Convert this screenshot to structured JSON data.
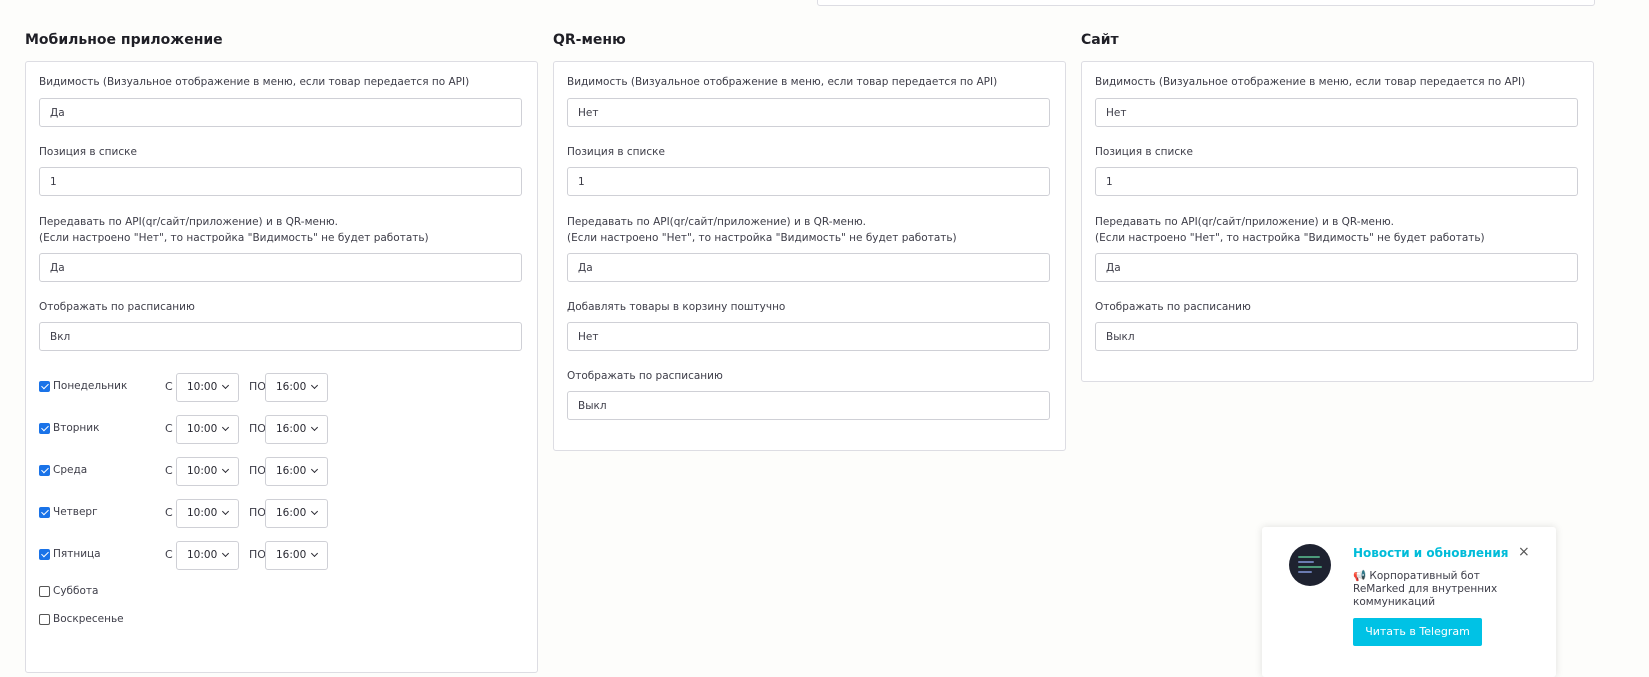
{
  "sections": [
    {
      "title": "Мобильное приложение",
      "visibility": {
        "label": "Видимость (Визуальное отображение в меню, если товар передается по API)",
        "value": "Да"
      },
      "position": {
        "label": "Позиция в списке",
        "value": "1"
      },
      "api": {
        "label_line1": "Передавать по API(qr/сайт/приложение) и в QR-меню.",
        "label_line2": "(Если настроено \"Нет\", то настройка \"Видимость\" не будет работать)",
        "value": "Да"
      },
      "schedule": {
        "label": "Отображать по расписанию",
        "value": "Вкл"
      },
      "days": [
        {
          "name": "Понедельник",
          "checked": true,
          "from": "10:00",
          "to": "16:00"
        },
        {
          "name": "Вторник",
          "checked": true,
          "from": "10:00",
          "to": "16:00"
        },
        {
          "name": "Среда",
          "checked": true,
          "from": "10:00",
          "to": "16:00"
        },
        {
          "name": "Четверг",
          "checked": true,
          "from": "10:00",
          "to": "16:00"
        },
        {
          "name": "Пятница",
          "checked": true,
          "from": "10:00",
          "to": "16:00"
        },
        {
          "name": "Суббота",
          "checked": false
        },
        {
          "name": "Воскресенье",
          "checked": false
        }
      ],
      "from_label": "С",
      "to_label": "ПО"
    },
    {
      "title": "QR-меню",
      "visibility": {
        "label": "Видимость (Визуальное отображение в меню, если товар передается по API)",
        "value": "Нет"
      },
      "position": {
        "label": "Позиция в списке",
        "value": "1"
      },
      "api": {
        "label_line1": "Передавать по API(qr/сайт/приложение) и в QR-меню.",
        "label_line2": "(Если настроено \"Нет\", то настройка \"Видимость\" не будет работать)",
        "value": "Да"
      },
      "cart": {
        "label": "Добавлять товары в корзину поштучно",
        "value": "Нет"
      },
      "schedule": {
        "label": "Отображать по расписанию",
        "value": "Выкл"
      }
    },
    {
      "title": "Сайт",
      "visibility": {
        "label": "Видимость (Визуальное отображение в меню, если товар передается по API)",
        "value": "Нет"
      },
      "position": {
        "label": "Позиция в списке",
        "value": "1"
      },
      "api": {
        "label_line1": "Передавать по API(qr/сайт/приложение) и в QR-меню.",
        "label_line2": "(Если настроено \"Нет\", то настройка \"Видимость\" не будет работать)",
        "value": "Да"
      },
      "schedule": {
        "label": "Отображать по расписанию",
        "value": "Выкл"
      }
    }
  ],
  "popup": {
    "title": "Новости и обновления",
    "close": "×",
    "text": "📢 Корпоративный бот ReMarked для внутренних коммуникаций",
    "button": "Читать в Telegram",
    "title_color": "#00bcd9",
    "button_color": "#00c2e5"
  },
  "icons": {
    "chevron": "chevron-down-icon",
    "check": "checkbox-checked-icon"
  }
}
